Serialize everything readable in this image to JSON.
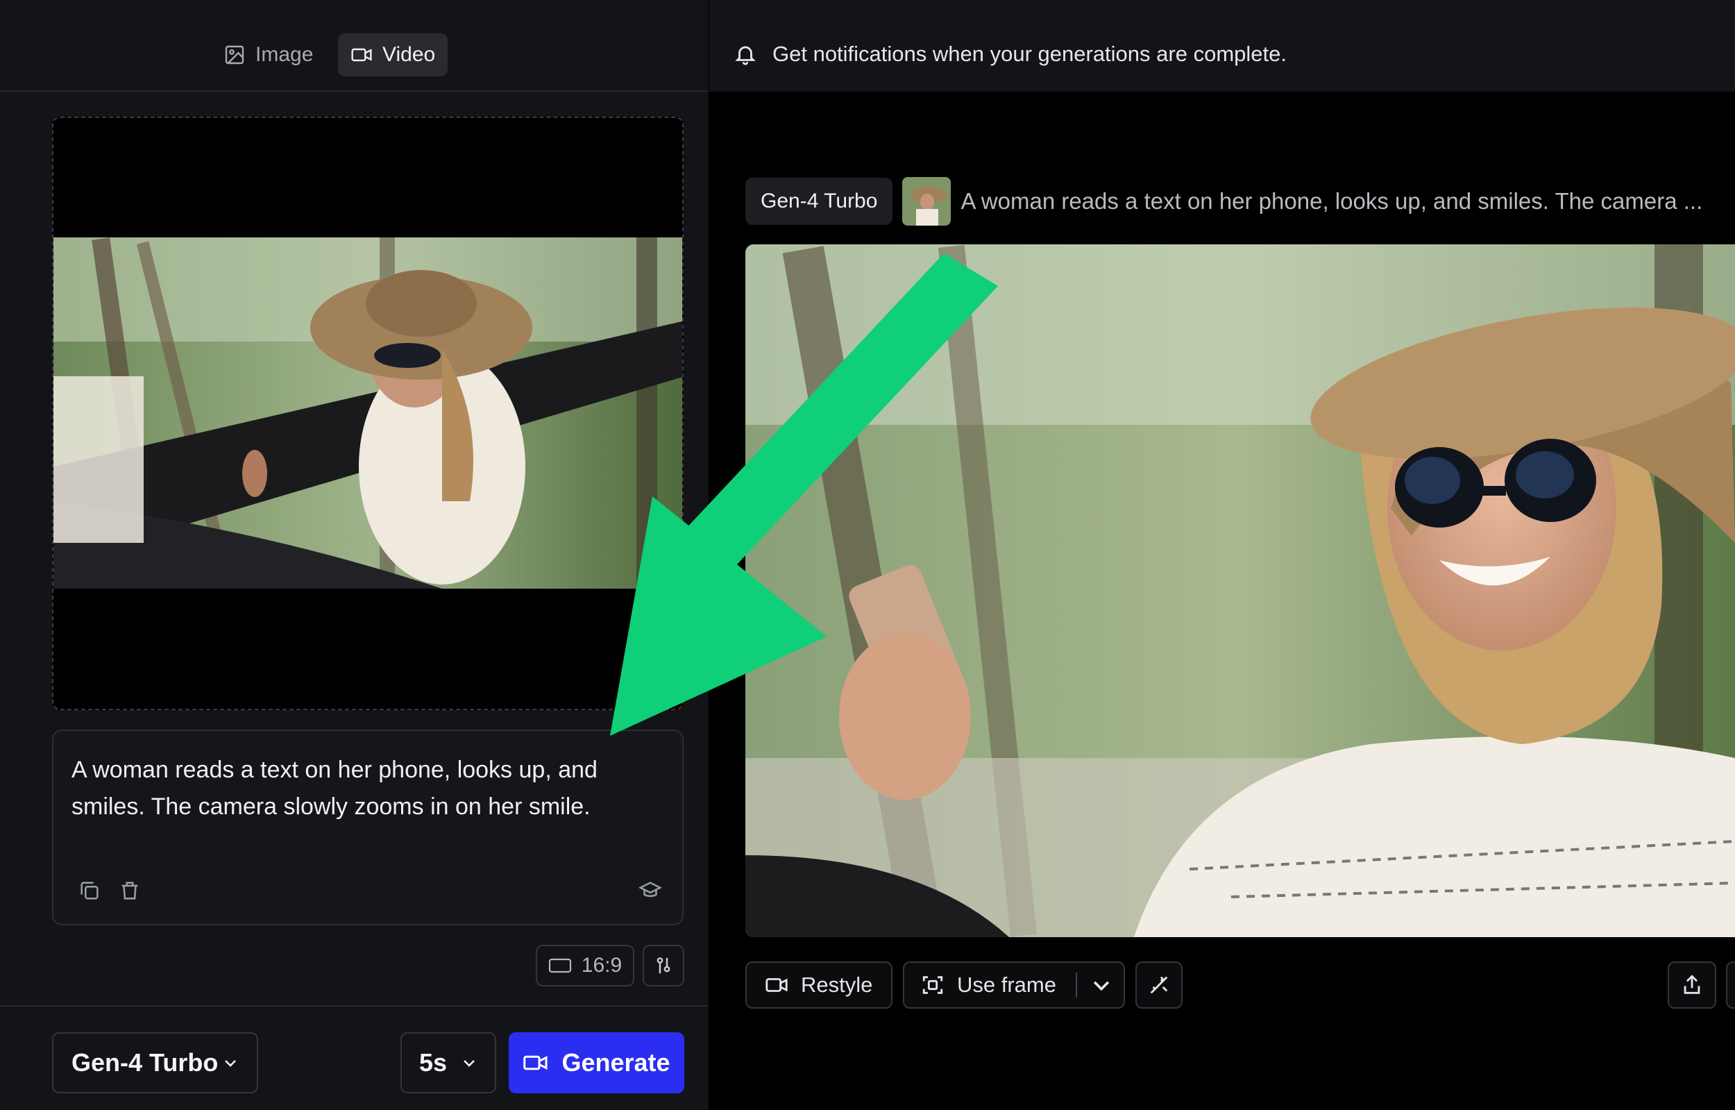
{
  "mode_tabs": [
    {
      "label": "Image",
      "icon": "image-icon",
      "active": false
    },
    {
      "label": "Video",
      "icon": "video-icon",
      "active": true
    }
  ],
  "notification": {
    "text": "Get notifications when your generations are complete.",
    "icon": "bell-icon"
  },
  "prompt": {
    "text": "A woman reads a text on her phone, looks up, and smiles. The camera slowly zooms in on her smile."
  },
  "settings": {
    "aspect_ratio": "16:9"
  },
  "bottom_bar": {
    "model": "Gen-4 Turbo",
    "duration": "5s",
    "generate_label": "Generate"
  },
  "generation": {
    "model_tag": "Gen-4 Turbo",
    "prompt_preview": "A woman reads a text on her phone, looks up, and smiles. The camera ..."
  },
  "actions": {
    "restyle": "Restyle",
    "use_frame": "Use frame"
  },
  "colors": {
    "accent": "#2b2ef0",
    "annotation_arrow": "#0fcf78",
    "panel": "#131417"
  }
}
